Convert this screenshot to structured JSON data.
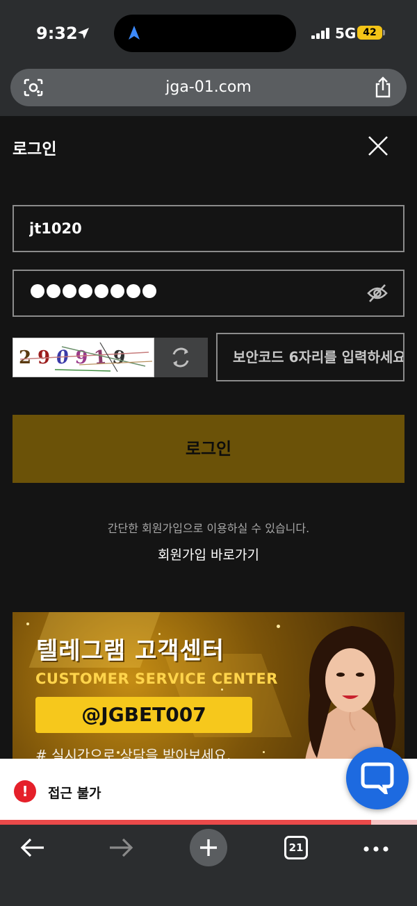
{
  "status_bar": {
    "time": "9:32",
    "network": "5G",
    "battery": "42"
  },
  "browser": {
    "url": "jga-01.com",
    "tab_count": "21"
  },
  "login": {
    "title": "로그인",
    "username_value": "jt1020",
    "password_dot_count": 8,
    "captcha_digits": [
      "2",
      "9",
      "0",
      "9",
      "1",
      "9"
    ],
    "captcha_placeholder": "보안코드 6자리를 입력하세요",
    "submit_label": "로그인",
    "signup_hint": "간단한 회원가입으로 이용하실 수 있습니다.",
    "signup_link": "회원가입 바로가기"
  },
  "banner": {
    "title": "텔레그램 고객센터",
    "subtitle": "CUSTOMER SERVICE CENTER",
    "handle": "@JGBET007",
    "note": "# 실시간으로 상담을 받아보세요."
  },
  "notice": {
    "text": "접근 불가",
    "progress": 0.89
  },
  "colors": {
    "accent": "#6b5208",
    "alert": "#e5202a",
    "chat": "#1d6ae0"
  }
}
